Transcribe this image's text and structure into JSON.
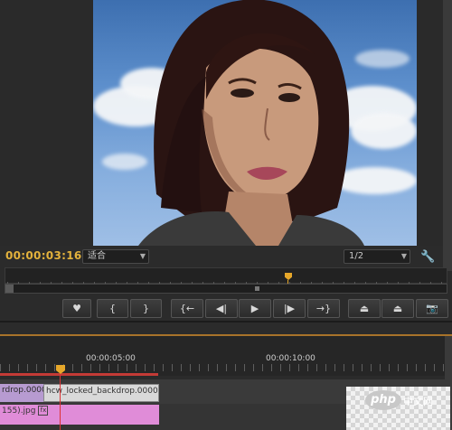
{
  "monitor": {
    "timecode": "00:00:03:16",
    "fit_select": "适合",
    "resolution_select": "1/2"
  },
  "transport": [
    {
      "name": "add-marker-button",
      "glyph": "♥"
    },
    {
      "name": "mark-in-button",
      "glyph": "{"
    },
    {
      "name": "mark-out-button",
      "glyph": "}"
    },
    {
      "name": "go-to-in-button",
      "glyph": "{←"
    },
    {
      "name": "step-back-button",
      "glyph": "◀|"
    },
    {
      "name": "play-button",
      "glyph": "▶"
    },
    {
      "name": "step-forward-button",
      "glyph": "|▶"
    },
    {
      "name": "go-to-out-button",
      "glyph": "→}"
    },
    {
      "name": "lift-button",
      "glyph": "⏏"
    },
    {
      "name": "extract-button",
      "glyph": "⏏"
    },
    {
      "name": "export-frame-button",
      "glyph": "📷"
    }
  ],
  "timeline": {
    "ruler_labels": [
      "00:00:05:00",
      "00:00:10:00"
    ],
    "clips": {
      "v1_a": "rdrop.0000",
      "v1_b": "hcw_locked_backdrop.0000",
      "v2": "155).jpg",
      "fx": "fx"
    }
  },
  "watermark": {
    "badge": "php",
    "text": "中文网"
  }
}
